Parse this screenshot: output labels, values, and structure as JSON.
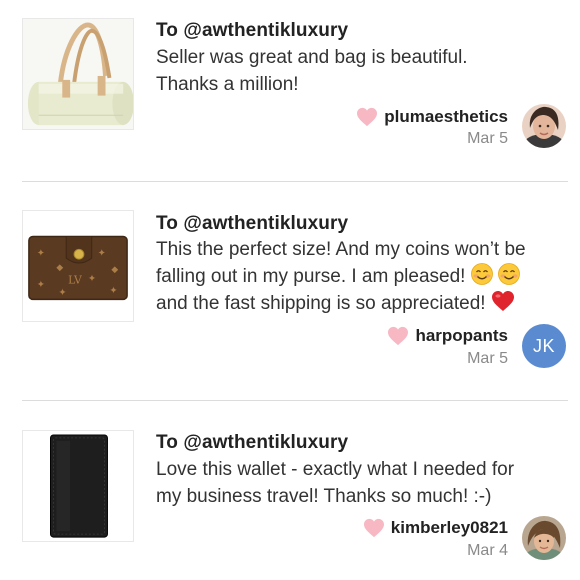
{
  "reviews": [
    {
      "to_line": "To @awthentikluxury",
      "body_lines": [
        "Seller was great and bag is beautiful.",
        "Thanks a million!"
      ],
      "username": "plumaesthetics",
      "date": "Mar 5",
      "avatar_type": "photo",
      "thumb": "green-barrel-bag"
    },
    {
      "to_line": "To @awthentikluxury",
      "body_lines": [
        "This the perfect size! And my coins won’t be",
        "falling out in my purse. I am pleased!",
        "and the fast shipping is so appreciated!"
      ],
      "emojis_line2": [
        "smiling-face-emoji",
        "smiling-face-emoji"
      ],
      "emoji_line3": "red-heart-emoji",
      "username": "harpopants",
      "date": "Mar 5",
      "avatar_type": "initials",
      "avatar_initials": "JK",
      "avatar_color": "#5a8ad0",
      "thumb": "monogram-wallet"
    },
    {
      "to_line": "To @awthentikluxury",
      "body_lines": [
        "Love this wallet - exactly what I needed for",
        "my business travel! Thanks so much! :-)"
      ],
      "username": "kimberley0821",
      "date": "Mar 4",
      "avatar_type": "photo",
      "thumb": "black-long-wallet"
    }
  ],
  "colors": {
    "heart": "#f7b8c3",
    "username": "#222222",
    "date": "#8a8a8a",
    "divider": "#dcdcdc"
  }
}
